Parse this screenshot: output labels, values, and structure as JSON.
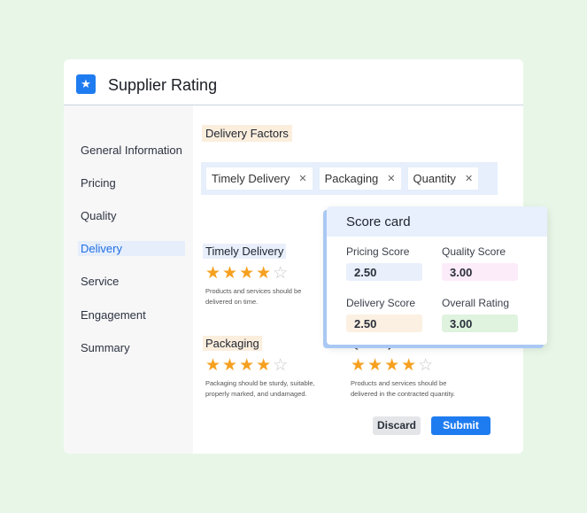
{
  "header": {
    "title": "Supplier Rating",
    "icon": "user-star-icon"
  },
  "sidebar": {
    "items": [
      {
        "label": "General Information"
      },
      {
        "label": "Pricing"
      },
      {
        "label": "Quality"
      },
      {
        "label": "Delivery",
        "active": true
      },
      {
        "label": "Service"
      },
      {
        "label": "Engagement"
      },
      {
        "label": "Summary"
      }
    ]
  },
  "main": {
    "section_title": "Delivery Factors",
    "chips": [
      {
        "label": "Timely Delivery"
      },
      {
        "label": "Packaging"
      },
      {
        "label": "Quantity"
      }
    ],
    "factors": [
      {
        "title": "Timely Delivery",
        "rating": 4,
        "max": 5,
        "desc": "Products and services should be delivered on time."
      },
      {
        "title": "Packaging",
        "rating": 4,
        "max": 5,
        "desc": "Packaging should be sturdy, suitable, properly marked, and undamaged."
      },
      {
        "title": "Quantity",
        "rating": 4,
        "max": 5,
        "desc": "Products and services should be delivered in the contracted quantity."
      }
    ]
  },
  "scorecard": {
    "title": "Score card",
    "pricing": {
      "label": "Pricing Score",
      "value": "2.50",
      "color": "#e9f0fb"
    },
    "quality": {
      "label": "Quality Score",
      "value": "3.00",
      "color": "#fcecfa"
    },
    "delivery": {
      "label": "Delivery Score",
      "value": "2.50",
      "color": "#fbf0e2"
    },
    "overall": {
      "label": "Overall Rating",
      "value": "3.00",
      "color": "#dff3df"
    }
  },
  "actions": {
    "discard": "Discard",
    "submit": "Submit"
  },
  "colors": {
    "accent": "#1f7cf0",
    "star": "#f6a020"
  }
}
